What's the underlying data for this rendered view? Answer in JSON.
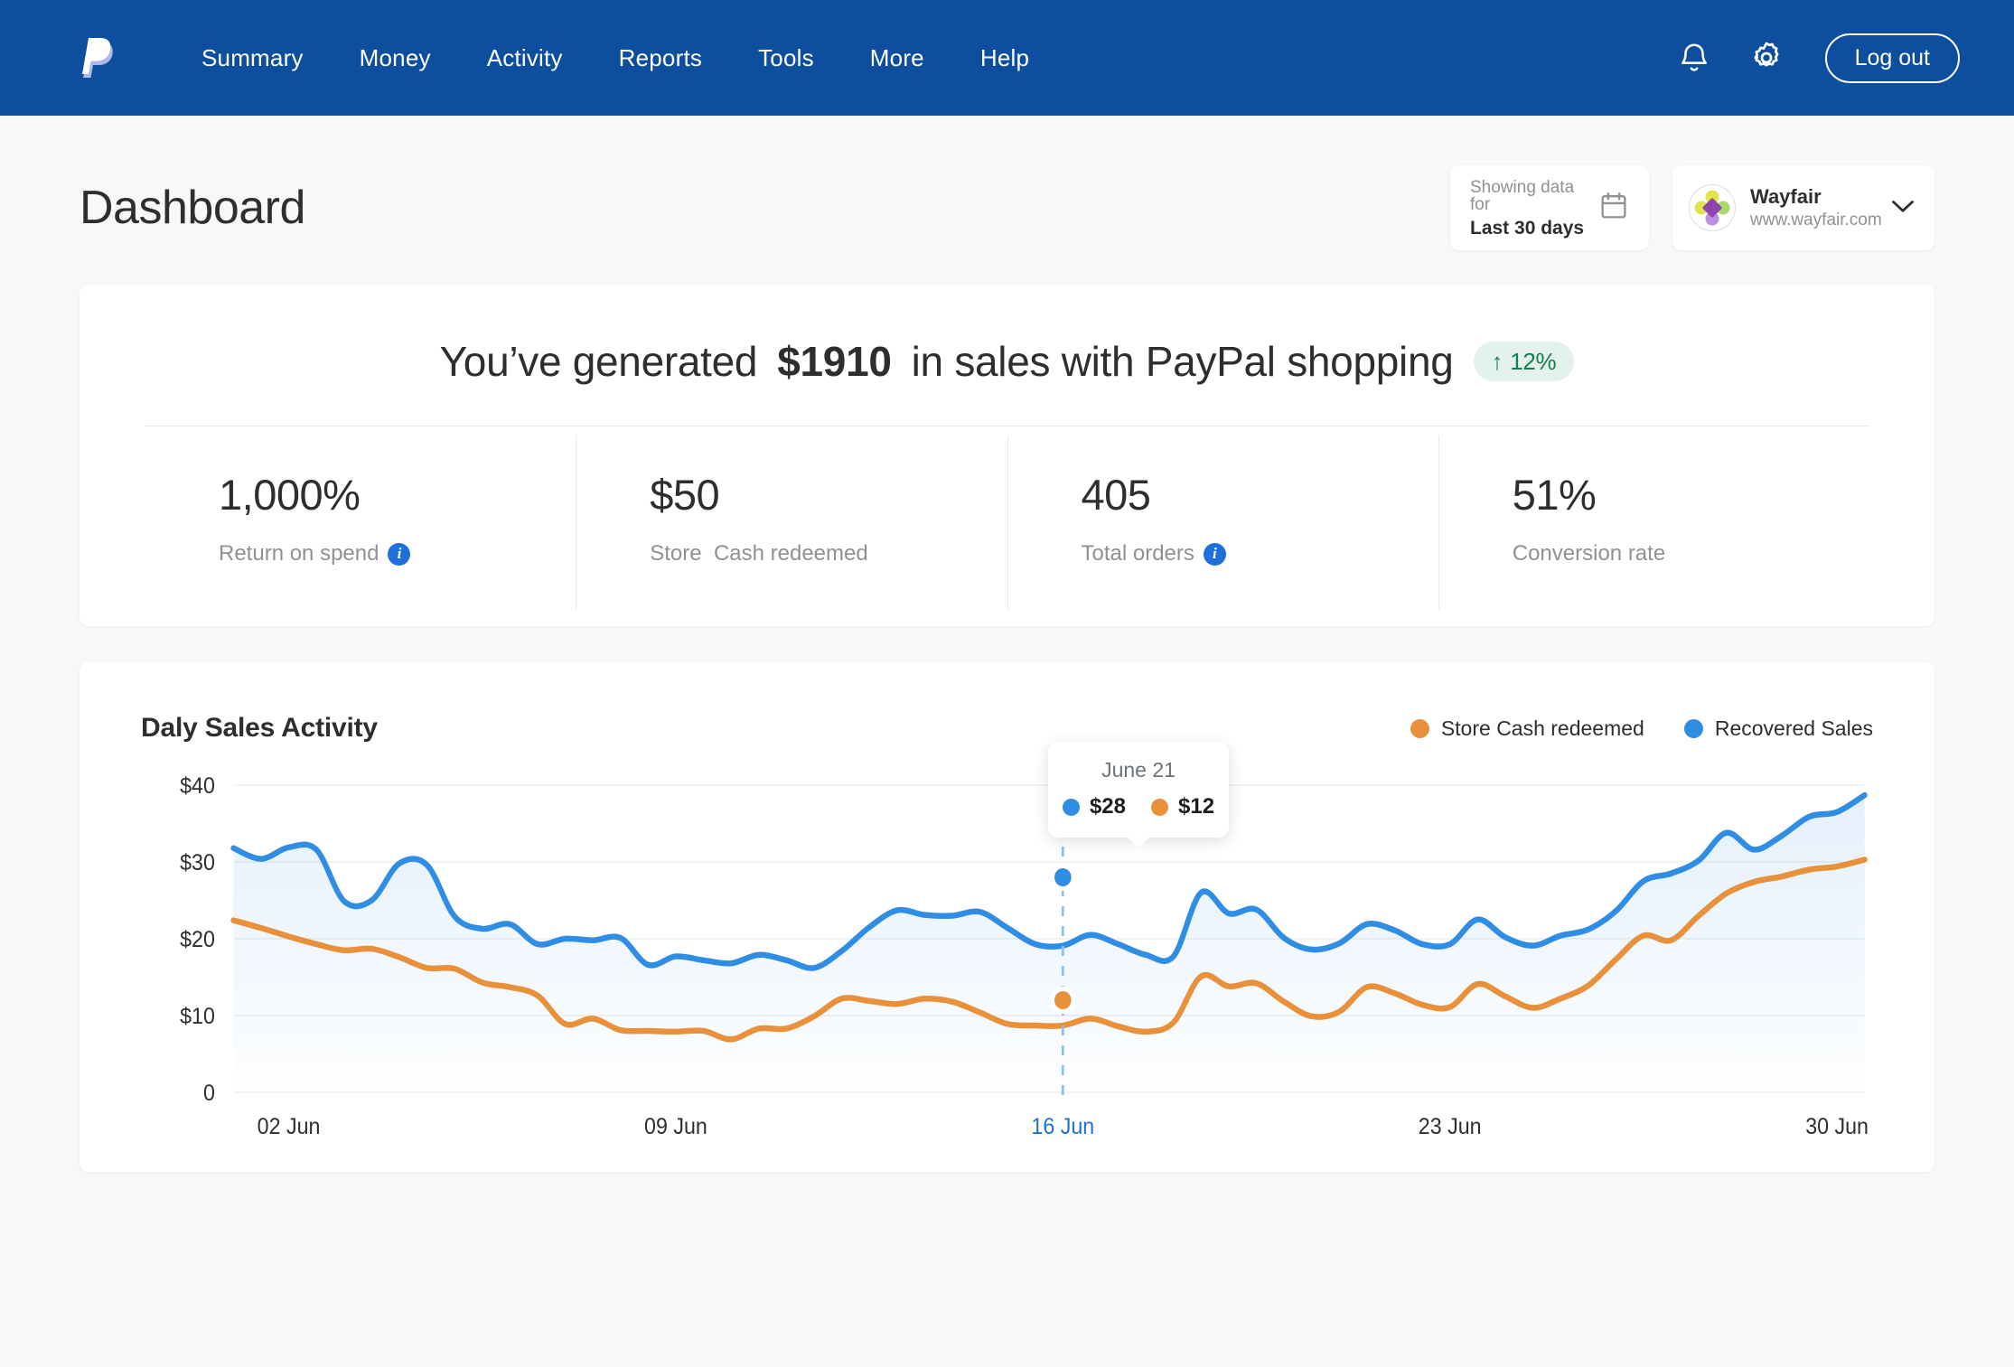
{
  "nav": {
    "logo_icon": "paypal-logo",
    "links": [
      {
        "label": "Summary"
      },
      {
        "label": "Money"
      },
      {
        "label": "Activity"
      },
      {
        "label": "Reports"
      },
      {
        "label": "Tools"
      },
      {
        "label": "More"
      },
      {
        "label": "Help"
      }
    ],
    "bell_icon": "notification-bell-icon",
    "gear_icon": "settings-gear-icon",
    "logout_label": "Log out",
    "bg_color": "#0d4f9e"
  },
  "page": {
    "title": "Dashboard"
  },
  "date_selector": {
    "label": "Showing data for",
    "value": "Last 30 days",
    "icon": "calendar-icon"
  },
  "merchant": {
    "name": "Wayfair",
    "url": "www.wayfair.com",
    "avatar_icon": "wayfair-logo",
    "chevron_icon": "chevron-down-icon"
  },
  "hero": {
    "text_before": "You’ve generated",
    "amount": "$1910",
    "text_after": "in sales with PayPal shopping",
    "badge": {
      "arrow": "↑",
      "value": "12%",
      "bg_color": "#e3f2ea",
      "text_color": "#177d56"
    }
  },
  "kpis": [
    {
      "value": "1,000%",
      "label": "Return on spend",
      "has_info": true
    },
    {
      "value": "$50",
      "label": "Store  Cash redeemed",
      "has_info": false
    },
    {
      "value": "405",
      "label": "Total orders",
      "has_info": true
    },
    {
      "value": "51%",
      "label": "Conversion rate",
      "has_info": false
    }
  ],
  "chart_card": {
    "title": "Daly Sales Activity",
    "legend": [
      {
        "label": "Store Cash redeemed",
        "color": "#e8913a"
      },
      {
        "label": "Recovered Sales",
        "color": "#2f8de4"
      }
    ],
    "tooltip": {
      "date": "June 21",
      "values": [
        {
          "value": "$28",
          "color": "#2f8de4"
        },
        {
          "value": "$12",
          "color": "#e8913a"
        }
      ]
    }
  },
  "chart_data": {
    "type": "line",
    "title": "Daly Sales Activity",
    "xlabel": "",
    "ylabel": "",
    "ylim": [
      0,
      40
    ],
    "ytick_labels": [
      "$40",
      "$30",
      "$20",
      "$10",
      "0"
    ],
    "ytick_values": [
      40,
      30,
      20,
      10,
      0
    ],
    "xtick_labels": [
      "02 Jun",
      "09 Jun",
      "16 Jun",
      "23 Jun",
      "30 Jun"
    ],
    "xtick_positions": [
      1,
      8,
      15,
      22,
      29
    ],
    "highlighted_xtick": "16 Jun",
    "grid": true,
    "legend_position": "top-right",
    "annotation": {
      "date": "June 21",
      "recovered_sales": 28,
      "store_cash_redeemed": 12,
      "x_index": 15
    },
    "x": [
      0,
      1,
      2,
      3,
      4,
      5,
      6,
      7,
      8,
      9,
      10,
      11,
      12,
      13,
      14,
      15,
      16,
      17,
      18,
      19,
      20,
      21,
      22,
      23,
      24,
      25,
      26,
      27,
      28,
      29,
      30,
      31,
      32,
      33,
      34,
      35,
      36,
      37,
      38,
      39,
      40,
      41,
      42,
      43,
      44,
      45,
      46,
      47,
      48,
      49,
      50,
      51,
      52,
      53,
      54,
      55,
      56,
      57,
      58,
      59
    ],
    "series": [
      {
        "name": "Recovered Sales",
        "color": "#2f8de4",
        "values": [
          31.8,
          30.4,
          31.9,
          31.6,
          24.9,
          25.0,
          29.8,
          29.6,
          22.9,
          21.3,
          21.9,
          19.3,
          20.0,
          19.8,
          20.1,
          16.6,
          17.7,
          17.2,
          16.8,
          17.9,
          17.2,
          16.2,
          18.4,
          21.5,
          23.7,
          23.1,
          23.0,
          23.5,
          21.4,
          19.3,
          19.1,
          20.5,
          19.3,
          17.9,
          17.7,
          26.0,
          23.3,
          23.8,
          20.1,
          18.6,
          19.4,
          21.9,
          21.1,
          19.3,
          19.3,
          22.5,
          20.2,
          19.1,
          20.4,
          21.2,
          23.6,
          27.5,
          28.5,
          30.2,
          33.8,
          31.6,
          33.4,
          35.9,
          36.5,
          38.7
        ]
      },
      {
        "name": "Store Cash redeemed",
        "color": "#e8913a",
        "values": [
          22.4,
          21.4,
          20.3,
          19.3,
          18.5,
          18.7,
          17.6,
          16.2,
          16.1,
          14.3,
          13.7,
          12.6,
          8.9,
          9.6,
          8.1,
          8.0,
          7.9,
          8.0,
          6.9,
          8.3,
          8.3,
          9.9,
          12.2,
          11.9,
          11.5,
          12.2,
          11.8,
          10.4,
          8.9,
          8.7,
          8.7,
          9.6,
          8.6,
          7.9,
          9.1,
          15.1,
          13.8,
          14.2,
          11.8,
          9.9,
          10.5,
          13.7,
          12.9,
          11.4,
          11.1,
          14.1,
          12.5,
          11.0,
          12.2,
          13.9,
          17.3,
          20.4,
          19.8,
          23.0,
          25.9,
          27.4,
          28.1,
          29.0,
          29.4,
          30.3
        ]
      }
    ]
  }
}
